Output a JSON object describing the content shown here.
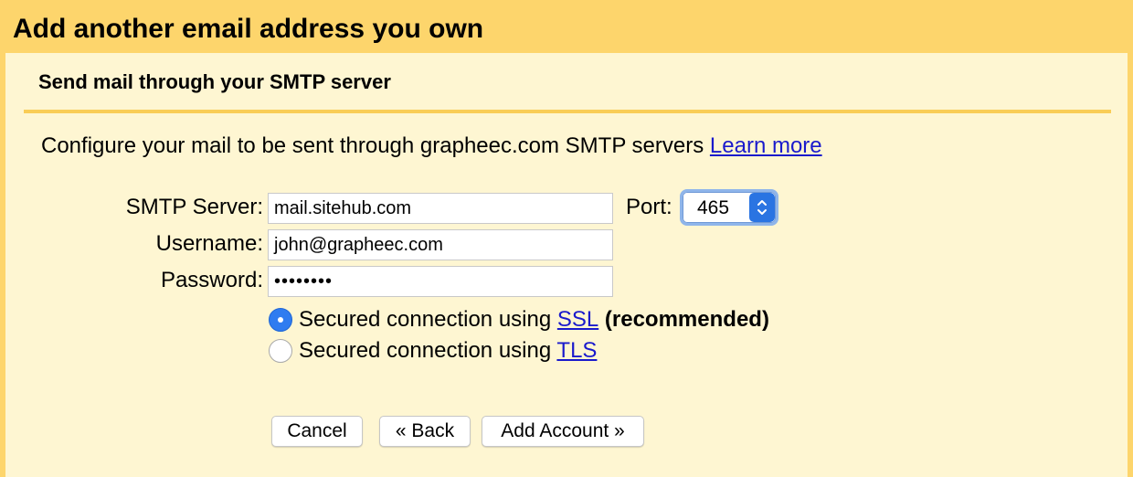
{
  "header": {
    "title": "Add another email address you own"
  },
  "section": {
    "title": "Send mail through your SMTP server"
  },
  "intro": {
    "text": "Configure your mail to be sent through grapheec.com SMTP servers ",
    "learn_more": "Learn more"
  },
  "form": {
    "smtp_label": "SMTP Server:",
    "smtp_value": "mail.sitehub.com",
    "port_label": "Port:",
    "port_value": "465",
    "username_label": "Username:",
    "username_value": "john@grapheec.com",
    "password_label": "Password:",
    "password_value": "••••••••"
  },
  "security": {
    "ssl_prefix": "Secured connection using ",
    "ssl_link": "SSL",
    "ssl_suffix": " (recommended)",
    "ssl_selected": true,
    "tls_prefix": "Secured connection using ",
    "tls_link": "TLS",
    "tls_selected": false
  },
  "buttons": {
    "cancel": "Cancel",
    "back": "« Back",
    "add_account": "Add Account »"
  },
  "colors": {
    "header_bg": "#fdd56c",
    "panel_bg": "#fef6d2",
    "divider": "#f9cd56",
    "link": "#1a1acc",
    "radio_selected": "#2f7cf0"
  }
}
